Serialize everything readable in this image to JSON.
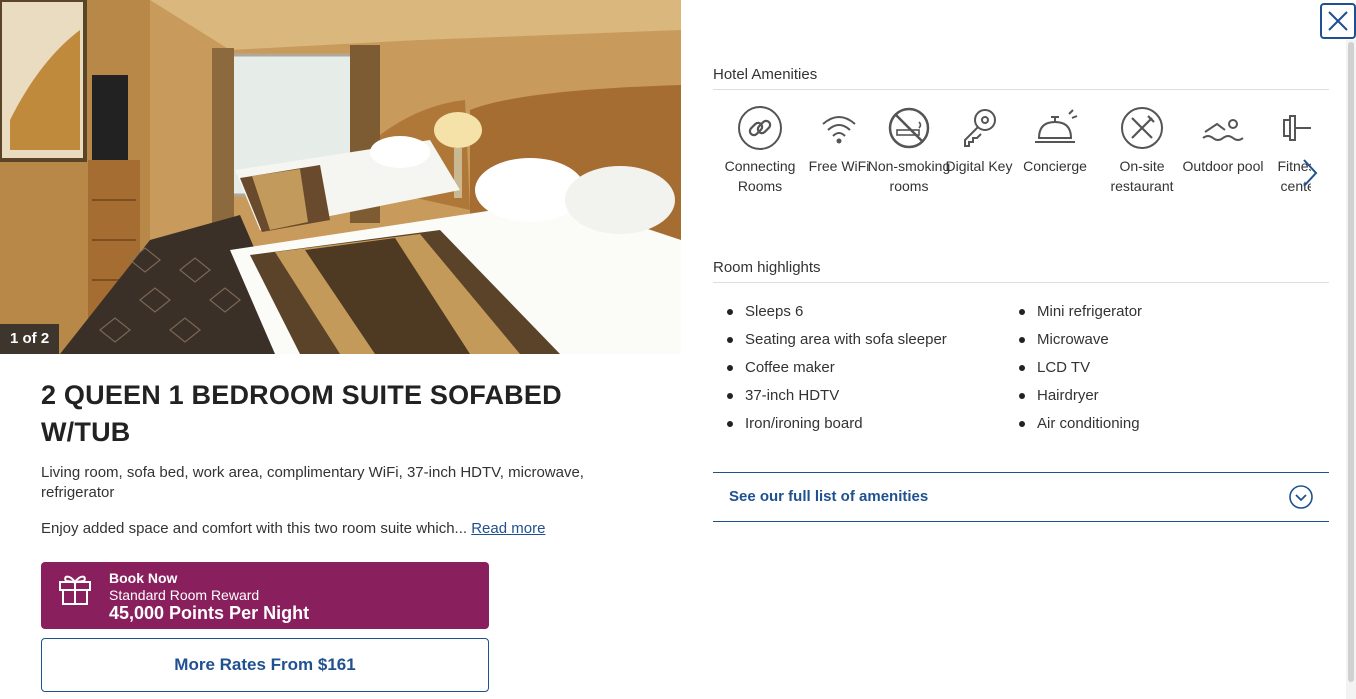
{
  "gallery": {
    "counter": "1 of 2",
    "image_alt": "Hotel suite bedroom with two queen beds"
  },
  "room": {
    "title": "2 QUEEN 1 BEDROOM SUITE SOFABED W/TUB",
    "description": "Living room, sofa bed, work area, complimentary WiFi, 37-inch HDTV, microwave, refrigerator",
    "teaser": "Enjoy added space and comfort with this two room suite which...",
    "read_more": "Read more"
  },
  "book_now": {
    "line1": "Book Now",
    "line2": "Standard Room Reward",
    "line3": "45,000 Points Per Night",
    "icon": "gift-icon"
  },
  "more_rates": {
    "label": "More Rates From $161"
  },
  "close": {
    "icon": "close-icon"
  },
  "amenities": {
    "heading": "Hotel Amenities",
    "items": [
      {
        "label": "Connecting Rooms",
        "icon": "link-icon"
      },
      {
        "label": "Free WiFi",
        "icon": "wifi-icon"
      },
      {
        "label": "Non-smoking rooms",
        "icon": "no-smoking-icon"
      },
      {
        "label": "Digital Key",
        "icon": "key-icon"
      },
      {
        "label": "Concierge",
        "icon": "service-bell-icon"
      },
      {
        "label": "On-site restaurant",
        "icon": "restaurant-icon"
      },
      {
        "label": "Outdoor pool",
        "icon": "swimmer-icon"
      },
      {
        "label": "Fitness center",
        "icon": "dumbbell-icon"
      }
    ],
    "next_icon": "chevron-right-icon"
  },
  "highlights": {
    "heading": "Room highlights",
    "col1": [
      "Sleeps 6",
      "Seating area with sofa sleeper",
      "Coffee maker",
      "37-inch HDTV",
      "Iron/ironing board"
    ],
    "col2": [
      "Mini refrigerator",
      "Microwave",
      "LCD TV",
      "Hairdryer",
      "Air conditioning"
    ]
  },
  "full_list": {
    "label": "See our full list of amenities",
    "icon": "chevron-down-circle-icon"
  },
  "colors": {
    "brand_blue": "#1f5190",
    "reward_purple": "#8a1f5e"
  }
}
